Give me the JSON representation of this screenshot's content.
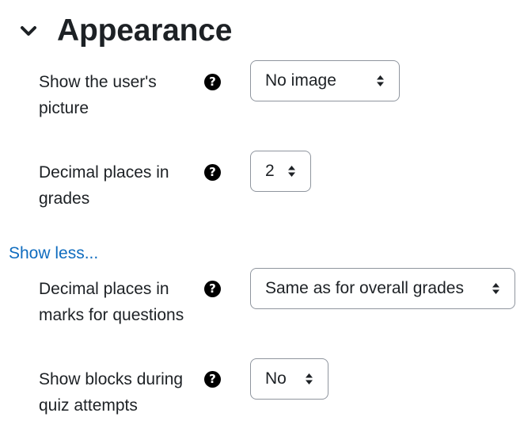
{
  "section": {
    "title": "Appearance",
    "toggle_icon": "chevron-down-icon"
  },
  "fields": [
    {
      "label": "Show the user's picture",
      "help_icon": "question-circle-icon",
      "value": "No image"
    },
    {
      "label": "Decimal places in grades",
      "help_icon": "question-circle-icon",
      "value": "2"
    },
    {
      "label": "Decimal places in marks for questions",
      "help_icon": "question-circle-icon",
      "value": "Same as for overall grades"
    },
    {
      "label": "Show blocks during quiz attempts",
      "help_icon": "question-circle-icon",
      "value": "No"
    }
  ],
  "show_less": "Show less...",
  "colors": {
    "text": "#1d2125",
    "link": "#0f6cbf",
    "select_border": "#8f959e"
  }
}
